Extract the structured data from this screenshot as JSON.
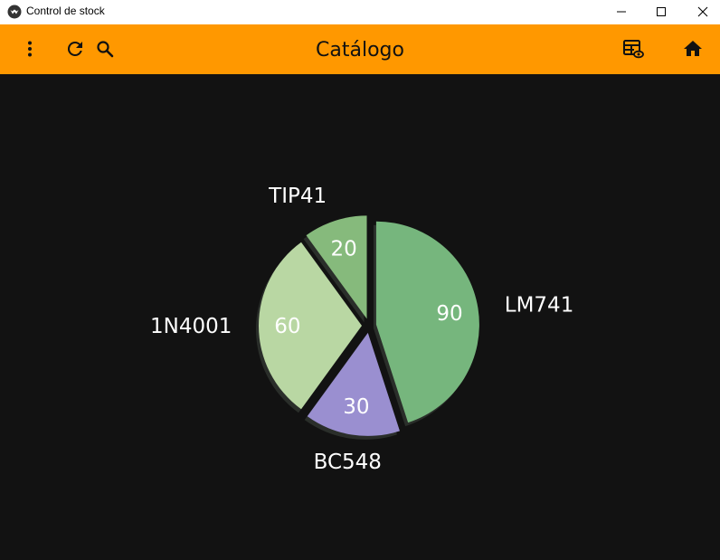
{
  "window": {
    "title": "Control de stock"
  },
  "appbar": {
    "title": "Catálogo",
    "icons": [
      "more-vert-icon",
      "refresh-icon",
      "search-icon",
      "table-view-icon",
      "home-icon"
    ],
    "background": "#FF9800"
  },
  "chart_data": {
    "type": "pie",
    "categories": [
      "LM741",
      "BC548",
      "1N4001",
      "TIP41"
    ],
    "values": [
      90,
      30,
      60,
      20
    ],
    "colors": [
      "#76B67D",
      "#9A8FD0",
      "#B9D7A3",
      "#86BA7C"
    ],
    "exploded": true,
    "title": ""
  }
}
